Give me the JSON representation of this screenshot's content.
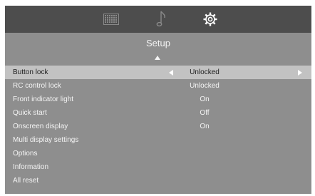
{
  "tabs": [
    {
      "icon": "picture-grid-icon",
      "active": false
    },
    {
      "icon": "music-note-icon",
      "active": false
    },
    {
      "icon": "gear-icon",
      "active": true
    }
  ],
  "menu": {
    "title": "Setup",
    "items": [
      {
        "label": "Button lock",
        "value": "Unlocked",
        "selected": true
      },
      {
        "label": "RC control lock",
        "value": "Unlocked"
      },
      {
        "label": "Front indicator light",
        "value": "On"
      },
      {
        "label": "Quick start",
        "value": "Off"
      },
      {
        "label": "Onscreen display",
        "value": "On"
      },
      {
        "label": "Multi display settings",
        "value": ""
      },
      {
        "label": "Options",
        "value": ""
      },
      {
        "label": "Information",
        "value": ""
      },
      {
        "label": "All reset",
        "value": ""
      }
    ]
  },
  "colors": {
    "panel": "#8e8e8e",
    "topbar": "#4d4d4d",
    "selected_row": "#c2c2c2"
  }
}
